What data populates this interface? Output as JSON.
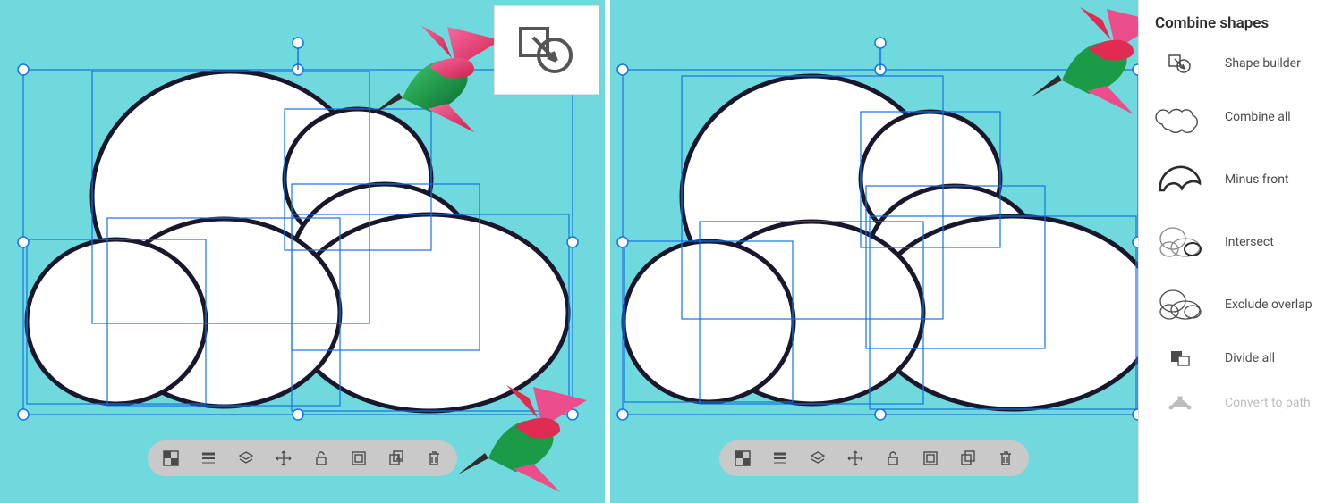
{
  "colors": {
    "canvas_bg": "#70d9de",
    "selection": "#1473e6",
    "shape_stroke": "#18172b",
    "shape_fill": "#ffffff",
    "bird_pink": "#ec4d8b",
    "bird_red": "#e02b52",
    "bird_green": "#1b9b48",
    "bird_green_dark": "#0d6b2f"
  },
  "icon_card": {
    "name": "shape-builder-icon"
  },
  "toolbar": {
    "items": [
      {
        "name": "transparency-icon"
      },
      {
        "name": "stroke-weight-icon"
      },
      {
        "name": "arrange-layers-icon"
      },
      {
        "name": "move-icon"
      },
      {
        "name": "unlock-icon"
      },
      {
        "name": "group-icon"
      },
      {
        "name": "duplicate-icon"
      },
      {
        "name": "delete-icon"
      }
    ]
  },
  "panel": {
    "title": "Combine shapes",
    "items": [
      {
        "name": "shape-builder",
        "label": "Shape builder",
        "enabled": true
      },
      {
        "name": "combine-all",
        "label": "Combine all",
        "enabled": true
      },
      {
        "name": "minus-front",
        "label": "Minus front",
        "enabled": true
      },
      {
        "name": "intersect",
        "label": "Intersect",
        "enabled": true
      },
      {
        "name": "exclude-overlap",
        "label": "Exclude overlap",
        "enabled": true
      },
      {
        "name": "divide-all",
        "label": "Divide all",
        "enabled": true
      },
      {
        "name": "convert-to-path",
        "label": "Convert to path",
        "enabled": false
      }
    ]
  }
}
